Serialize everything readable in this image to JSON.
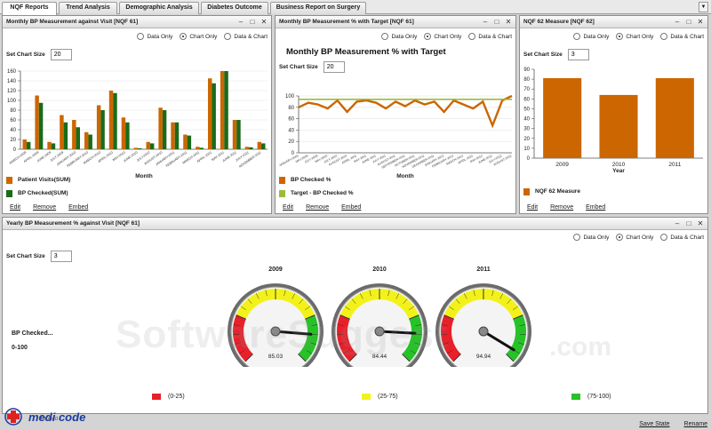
{
  "tabs": [
    {
      "label": "NQF Reports",
      "active": true
    },
    {
      "label": "Trend Analysis",
      "active": false
    },
    {
      "label": "Demographic Analysis",
      "active": false
    },
    {
      "label": "Diabetes Outcome",
      "active": false
    },
    {
      "label": "Business Report on Surgery",
      "active": false
    }
  ],
  "radio_labels": {
    "data_only": "Data Only",
    "chart_only": "Chart Only",
    "data_chart": "Data & Chart"
  },
  "set_chart_size_label": "Set Chart Size",
  "actions": {
    "edit": "Edit",
    "remove": "Remove",
    "embed": "Embed"
  },
  "footer": {
    "save_state": "Save State",
    "rename": "Rename"
  },
  "panel1": {
    "title": "Monthly BP Measurement against Visit [NQF 61]",
    "chart_size": "20"
  },
  "panel2": {
    "title": "Monthly BP Measurement % with Target [NQF 61]",
    "chart_size": "20"
  },
  "panel3": {
    "title": "NQF 62 Measure [NQF 62]",
    "chart_size": "3"
  },
  "panel4": {
    "title": "Yearly BP Measurement % against Visit [NQF 61]",
    "chart_size": "3",
    "side_label": "BP Checked...",
    "side_range": "0-100",
    "range_legend": [
      {
        "label": "(0-25)",
        "color": "#e8202a"
      },
      {
        "label": "(25-75)",
        "color": "#f2f21a"
      },
      {
        "label": "(75-100)",
        "color": "#27c227"
      }
    ]
  },
  "watermark": {
    "text": "SoftwareSuggest",
    "suffix": ".com"
  },
  "logo": {
    "text": "medi code",
    "tagline": "Embed"
  },
  "chart_data": [
    {
      "type": "bar",
      "xlabel": "Month",
      "ylabel": "",
      "ylim": [
        0,
        160
      ],
      "yticks": [
        0,
        20,
        40,
        60,
        80,
        100,
        120,
        140,
        160
      ],
      "categories": [
        "MARCH-2009",
        "APRIL-2009",
        "JUNE-2009",
        "JULY-2009",
        "JANUARY-2010",
        "FEBRUARY-2010",
        "MARCH-2010",
        "APRIL-2010",
        "MAY-2010",
        "JUNE-2010",
        "JULY-2010",
        "AUGUST-2010",
        "JANUARY-2011",
        "FEBRUARY-2011",
        "MARCH-2011",
        "APRIL-2011",
        "MAY-2011",
        "JUNE-2011",
        "JULY-2011",
        "NOVEMBER-2011"
      ],
      "series": [
        {
          "name": "Patient Visits(SUM)",
          "color": "#cc6600",
          "values": [
            20,
            110,
            15,
            70,
            60,
            35,
            90,
            120,
            65,
            3,
            15,
            85,
            55,
            30,
            5,
            145,
            180,
            60,
            5,
            15
          ]
        },
        {
          "name": "BP Checked(SUM)",
          "color": "#1a6b1a",
          "values": [
            15,
            95,
            12,
            55,
            45,
            30,
            80,
            115,
            55,
            2,
            12,
            80,
            55,
            28,
            3,
            135,
            175,
            60,
            4,
            12
          ]
        }
      ]
    },
    {
      "type": "line",
      "title": "Monthly BP Measurement % with Target",
      "xlabel": "Month",
      "ylabel": "",
      "ylim": [
        0,
        100
      ],
      "yticks": [
        0,
        20,
        40,
        60,
        80,
        100
      ],
      "categories": [
        "JANUARY-2009",
        "MAY-2009",
        "JULY-2009",
        "MAY-2010",
        "JULY-2010",
        "AUGUST-2010",
        "APRIL-2011",
        "MAY-2011",
        "JUNE-2011",
        "JULY-2011",
        "AUGUST-2011",
        "SEPTEMBER-2011",
        "OCTOBER-2011",
        "NOVEMBER-2011",
        "DECEMBER-2011",
        "JANUARY-2012",
        "FEBRUARY-2012",
        "MARCH-2012",
        "APRIL-2012",
        "MAY-2012",
        "JUNE-2012",
        "JULY-2012",
        "AUGUST-2012"
      ],
      "series": [
        {
          "name": "BP Checked %",
          "color": "#cc6600",
          "values": [
            80,
            88,
            85,
            78,
            92,
            72,
            90,
            92,
            88,
            78,
            90,
            82,
            92,
            85,
            90,
            72,
            92,
            85,
            78,
            90,
            48,
            92,
            100
          ]
        },
        {
          "name": "Target - BP Checked %",
          "color": "#9bbb3b",
          "values": [
            94,
            94,
            94,
            94,
            94,
            94,
            94,
            94,
            94,
            94,
            94,
            94,
            94,
            94,
            94,
            94,
            94,
            94,
            94,
            94,
            94,
            94,
            94
          ]
        }
      ]
    },
    {
      "type": "bar",
      "xlabel": "Year",
      "ylabel": "",
      "ylim": [
        0,
        90
      ],
      "yticks": [
        0,
        10,
        20,
        30,
        40,
        50,
        60,
        70,
        80,
        90
      ],
      "categories": [
        "2009",
        "2010",
        "2011"
      ],
      "series": [
        {
          "name": "NQF 62 Measure",
          "color": "#cc6600",
          "values": [
            81,
            64,
            81
          ]
        }
      ]
    },
    {
      "type": "gauge",
      "ylim": [
        0,
        100
      ],
      "categories": [
        "2009",
        "2010",
        "2011"
      ],
      "values": [
        85.03,
        84.44,
        94.94
      ],
      "value_labels": [
        "85.03",
        "84.44",
        "94.94"
      ]
    }
  ]
}
